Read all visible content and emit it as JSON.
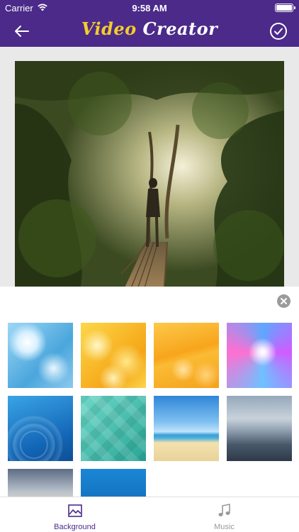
{
  "status_bar": {
    "carrier": "Carrier",
    "time": "9:58 AM"
  },
  "nav": {
    "title_part1": "Video",
    "title_part2": "Creator",
    "back_icon": "arrow-left-icon",
    "done_icon": "checkmark-circle-icon"
  },
  "colors": {
    "nav_background": "#4b2a8a",
    "title_accent": "#f5cc2b",
    "tab_active": "#4b2a8a",
    "tab_inactive": "#9a9a9a"
  },
  "sheet": {
    "close_icon": "close-circle-icon",
    "backgrounds": [
      "light-blue-bokeh",
      "yellow-bokeh",
      "orange-waves",
      "purple-light-burst",
      "blue-circles",
      "teal-diamonds",
      "beach",
      "city-skyline",
      "sunset-dock",
      "blue-sparkle"
    ]
  },
  "tabs": [
    {
      "label": "Background",
      "icon": "image-icon",
      "active": true
    },
    {
      "label": "Music",
      "icon": "music-note-icon",
      "active": false
    }
  ]
}
